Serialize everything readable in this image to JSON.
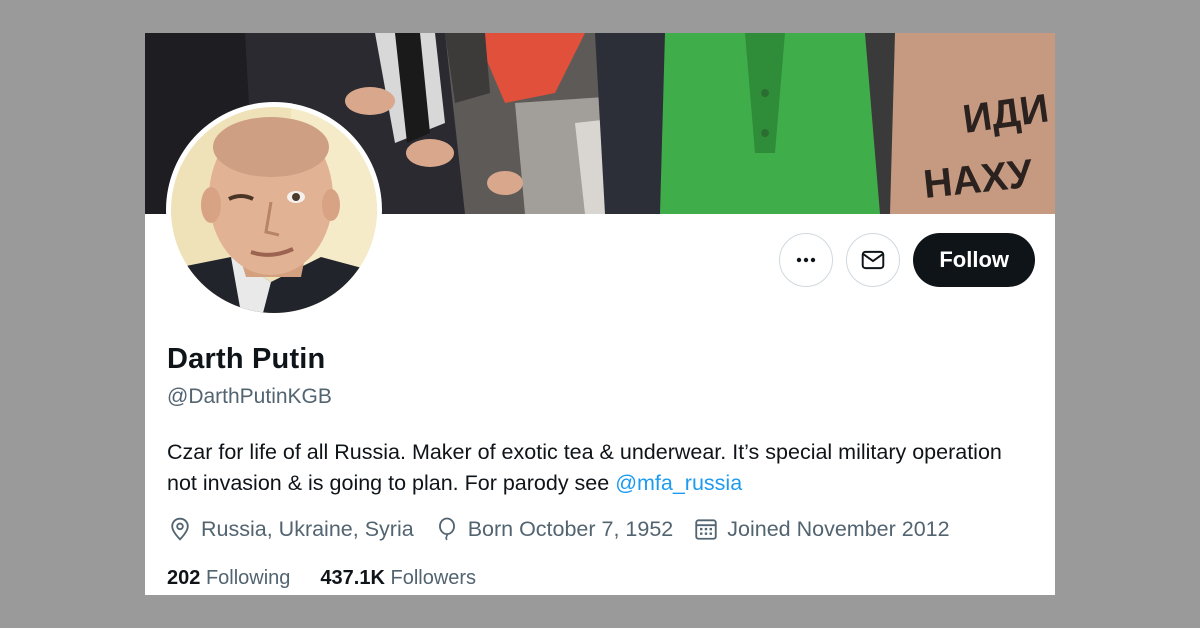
{
  "profile": {
    "name": "Darth Putin",
    "handle": "@DarthPutinKGB",
    "bio_text": "Czar for life of all Russia. Maker of exotic tea & underwear. It’s special military operation not invasion & is going to plan. For parody see ",
    "bio_mention": "@mfa_russia",
    "location": "Russia, Ukraine, Syria",
    "born": "Born October 7, 1952",
    "joined": "Joined November 2012",
    "following_count": "202",
    "following_label": "Following",
    "followers_count": "437.1K",
    "followers_label": "Followers"
  },
  "actions": {
    "more_icon": "more-icon",
    "message_icon": "envelope-icon",
    "follow_label": "Follow"
  },
  "banner": {
    "lettering": "ИДИ НАХУ"
  },
  "colors": {
    "link": "#1d9bf0",
    "text": "#0f1419",
    "secondary": "#536471",
    "follow_bg": "#0f1419"
  }
}
